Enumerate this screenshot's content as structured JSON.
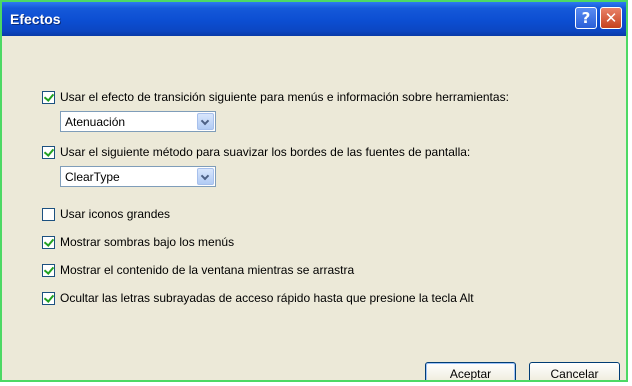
{
  "window": {
    "title": "Efectos"
  },
  "titlebar": {
    "help_glyph": "?",
    "close_glyph": "✕"
  },
  "options": [
    {
      "label": "Usar el efecto de transición siguiente para menús e información sobre herramientas:",
      "checked": true
    },
    {
      "label": "Usar el siguiente método para suavizar los bordes de las fuentes de pantalla:",
      "checked": true
    },
    {
      "label": "Usar iconos grandes",
      "checked": false
    },
    {
      "label": "Mostrar sombras bajo los menús",
      "checked": true
    },
    {
      "label": "Mostrar el contenido de la ventana mientras se arrastra",
      "checked": true
    },
    {
      "label": "Ocultar las letras subrayadas de acceso rápido hasta que presione la tecla Alt",
      "checked": true
    }
  ],
  "combos": {
    "transition": {
      "value": "Atenuación"
    },
    "smoothing": {
      "value": "ClearType"
    }
  },
  "buttons": {
    "ok_label": "Aceptar",
    "cancel_label": "Cancelar"
  },
  "colors": {
    "titlebar": "#0c4ed2",
    "dialog_bg": "#ece9d8",
    "frame": "#4cd964",
    "check": "#21a121"
  }
}
